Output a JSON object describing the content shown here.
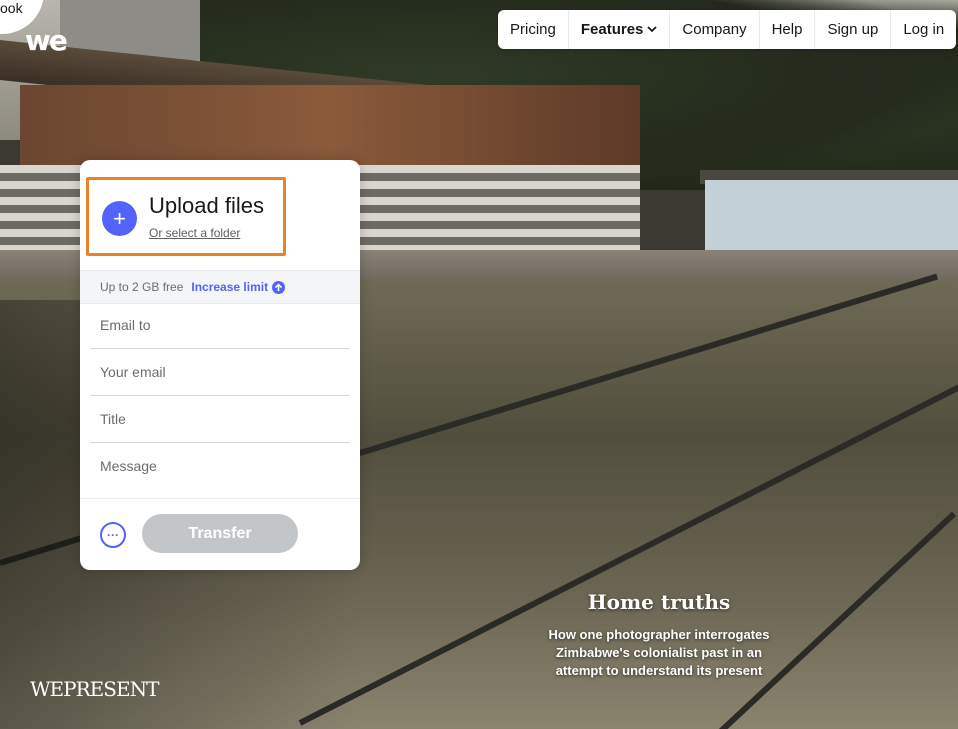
{
  "logo": {
    "partial_text": "ook",
    "wordmark": "we"
  },
  "nav": {
    "items": [
      {
        "label": "Pricing"
      },
      {
        "label": "Features"
      },
      {
        "label": "Company"
      },
      {
        "label": "Help"
      },
      {
        "label": "Sign up"
      },
      {
        "label": "Log in"
      }
    ],
    "features_icon": "chevron-down-icon"
  },
  "panel": {
    "upload_title": "Upload files",
    "upload_sub": "Or select a folder",
    "plus_icon": "+",
    "limit_text": "Up to 2 GB free",
    "limit_link": "Increase limit",
    "limit_icon": "arrow-up-icon",
    "fields": {
      "email_to": "Email to",
      "your_email": "Your email",
      "title": "Title",
      "message": "Message"
    },
    "more_icon": "···",
    "transfer_label": "Transfer",
    "accent": "#5363fa",
    "highlight": "#e8832c"
  },
  "story": {
    "title": "Home truths",
    "subtitle": "How one photographer interrogates Zimbabwe's colonialist past in an attempt to understand its present",
    "brand": "WEPRESENT"
  }
}
